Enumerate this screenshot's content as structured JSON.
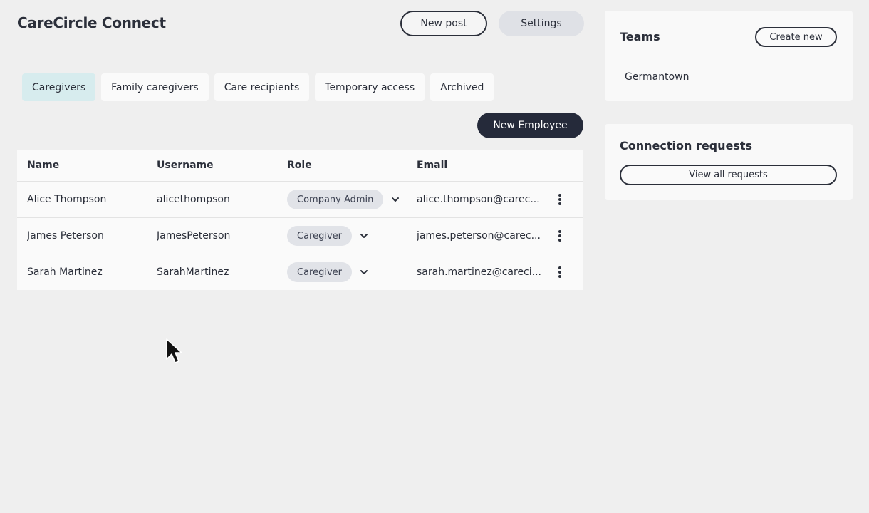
{
  "app": {
    "title": "CareCircle Connect"
  },
  "header": {
    "new_post_label": "New post",
    "settings_label": "Settings"
  },
  "tabs": [
    {
      "label": "Caregivers",
      "active": true
    },
    {
      "label": "Family caregivers",
      "active": false
    },
    {
      "label": "Care recipients",
      "active": false
    },
    {
      "label": "Temporary access",
      "active": false
    },
    {
      "label": "Archived",
      "active": false
    }
  ],
  "actions": {
    "new_employee_label": "New Employee"
  },
  "table": {
    "columns": [
      "Name",
      "Username",
      "Role",
      "Email"
    ],
    "rows": [
      {
        "name": "Alice Thompson",
        "username": "alicethompson",
        "role": "Company Admin",
        "email": "alice.thompson@carec..."
      },
      {
        "name": "James Peterson",
        "username": "JamesPeterson",
        "role": "Caregiver",
        "email": "james.peterson@carec..."
      },
      {
        "name": "Sarah Martinez",
        "username": "SarahMartinez",
        "role": "Caregiver",
        "email": "sarah.martinez@careci..."
      }
    ]
  },
  "teams": {
    "title": "Teams",
    "create_label": "Create new",
    "items": [
      "Germantown"
    ]
  },
  "connections": {
    "title": "Connection requests",
    "view_all_label": "View all requests"
  },
  "icons": {
    "row_menu": "kebab-menu-icon",
    "role_dropdown": "chevron-down-icon",
    "pointer": "mouse-cursor-icon"
  },
  "colors": {
    "primary_dark": "#252a3a",
    "active_tab": "#d7ecee",
    "pill_bg": "#e1e3e8",
    "page_bg": "#efefef"
  }
}
